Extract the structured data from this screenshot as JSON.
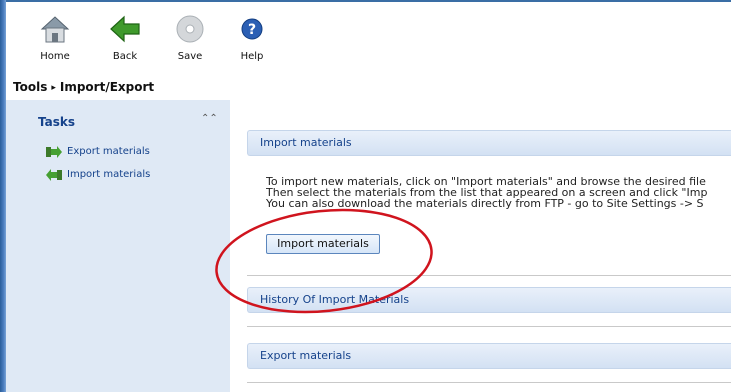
{
  "toolbar": {
    "items": [
      {
        "label": "Home",
        "icon": "home-icon"
      },
      {
        "label": "Back",
        "icon": "back-arrow-icon"
      },
      {
        "label": "Save",
        "icon": "save-disc-icon"
      },
      {
        "label": "Help",
        "icon": "help-icon"
      }
    ]
  },
  "breadcrumb": {
    "root": "Tools",
    "separator": "▸",
    "current": "Import/Export"
  },
  "sidebar": {
    "heading": "Tasks",
    "collapse_glyph": "⌃⌃",
    "tasks": [
      {
        "label": "Export materials",
        "icon": "export-arrow-icon"
      },
      {
        "label": "Import materials",
        "icon": "import-arrow-icon"
      }
    ]
  },
  "main": {
    "import_section": {
      "title": "Import materials",
      "lines": [
        "To import new materials, click on \"Import materials\" and browse the desired file",
        "Then select the materials from the list that appeared on a screen and click \"Imp",
        "You can also download the materials directly from FTP - go to Site Settings -> S"
      ],
      "button_label": "Import materials"
    },
    "history_section": {
      "title": "History Of Import Materials"
    },
    "export_section": {
      "title": "Export materials"
    }
  },
  "colors": {
    "accent_text": "#15428b",
    "sidebar_bg": "#dfe9f5",
    "annotation_oval": "#d0141e"
  }
}
